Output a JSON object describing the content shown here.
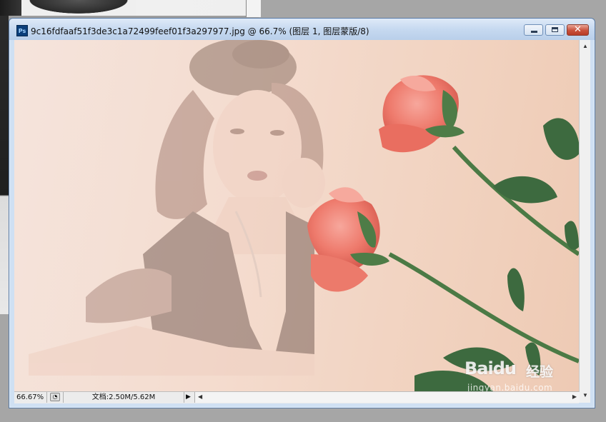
{
  "document": {
    "title": "9c16fdfaaf51f3de3c1a72499feef01f3a297977.jpg @ 66.7% (图层 1, 图层蒙版/8)",
    "app_icon_label": "Ps"
  },
  "status": {
    "zoom": "66.67%",
    "doc_info": "文档:2.50M/5.62M"
  },
  "watermark": {
    "brand": "Baidu",
    "brand_cn": "经验",
    "url": "jingyan.baidu.com"
  },
  "colors": {
    "canvas_tint": "#f3dccf",
    "title_bar": "#c6d9f0",
    "close_button": "#c9503b",
    "rose": "#ef7e72",
    "leaf": "#3b6a3c"
  },
  "icons": {
    "app": "photoshop-icon",
    "minimize": "minimize-icon",
    "maximize": "maximize-icon",
    "close": "close-icon",
    "status_menu": "status-menu-icon",
    "status_arrow": "triangle-right-icon"
  }
}
